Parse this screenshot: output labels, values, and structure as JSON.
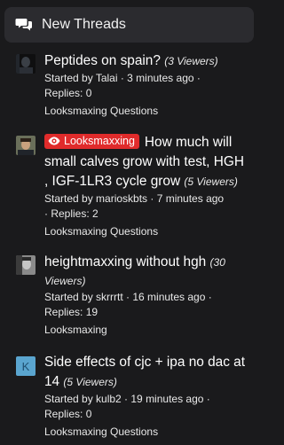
{
  "header": {
    "title": "New Threads"
  },
  "threads": [
    {
      "title": "Peptides on spain?",
      "viewers": "(3 Viewers)",
      "meta_line1": "Started by Talai · 3 minutes ago ·",
      "meta_line2": "Replies: 0",
      "forum": "Looksmaxing Questions",
      "avatar_icon": "avatar-dark-photo-icon"
    },
    {
      "badge": "Looksmaxxing",
      "title_line1": "How much will",
      "title_line2": "small calves grow with test, HGH",
      "title_line3": ", IGF-1LR3 cycle grow",
      "viewers": "(5 Viewers)",
      "meta_line1": "Started by marioskbts · 7 minutes ago",
      "meta_line2": "· Replies: 2",
      "forum": "Looksmaxing Questions",
      "avatar_icon": "avatar-photo-icon"
    },
    {
      "title": "heightmaxxing without hgh",
      "viewers_part1": "(30",
      "viewers_part2": "Viewers)",
      "meta_line1": "Started by skrrrtt · 16 minutes ago ·",
      "meta_line2": "Replies: 19",
      "forum": "Looksmaxing",
      "avatar_icon": "avatar-grayscale-photo-icon"
    },
    {
      "title_line1": "Side effects of cjc + ipa no dac at",
      "title_line2": "14",
      "viewers": "(5 Viewers)",
      "meta_line1": "Started by kulb2 · 19 minutes ago ·",
      "meta_line2": "Replies: 0",
      "forum": "Looksmaxing Questions",
      "avatar_letter": "K",
      "avatar_color": "#5aa5cf"
    }
  ]
}
